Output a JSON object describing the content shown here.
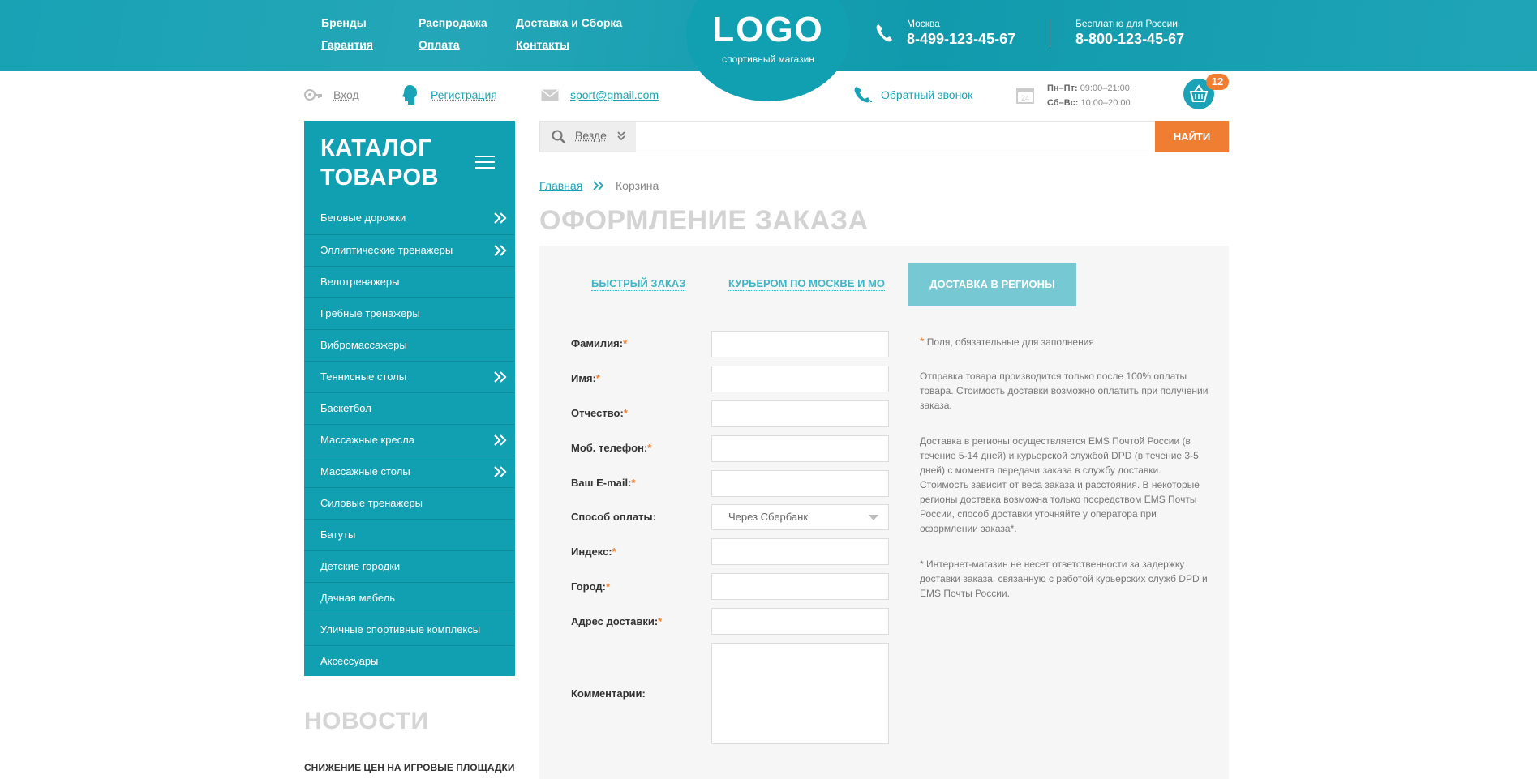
{
  "header": {
    "links": [
      "Бренды",
      "Распродажа",
      "Доставка и Сборка",
      "Гарантия",
      "Оплата",
      "Контакты"
    ],
    "logo": "LOGO",
    "logo_sub": "спортивный магазин",
    "city": "Москва",
    "phone": "8-499-123-45-67",
    "free_label": "Бесплатно для России",
    "free_phone": "8-800-123-45-67"
  },
  "subheader": {
    "login": "Вход",
    "register": "Регистрация",
    "email": "sport@gmail.com",
    "callback": "Обратный звонок",
    "hours_weekday_label": "Пн–Пт:",
    "hours_weekday": "09:00–21:00;",
    "hours_weekend_label": "Сб–Вс:",
    "hours_weekend": "10:00–20:00",
    "cart_count": "12"
  },
  "catalog": {
    "title_line1": "КАТАЛОГ",
    "title_line2": "ТОВАРОВ",
    "items": [
      {
        "label": "Беговые дорожки",
        "has_sub": true
      },
      {
        "label": "Эллиптические тренажеры",
        "has_sub": true
      },
      {
        "label": "Велотренажеры",
        "has_sub": false
      },
      {
        "label": "Гребные тренажеры",
        "has_sub": false
      },
      {
        "label": "Вибромассажеры",
        "has_sub": false
      },
      {
        "label": "Теннисные столы",
        "has_sub": true
      },
      {
        "label": "Баскетбол",
        "has_sub": false
      },
      {
        "label": "Массажные кресла",
        "has_sub": true
      },
      {
        "label": "Массажные столы",
        "has_sub": true
      },
      {
        "label": "Силовые тренажеры",
        "has_sub": false
      },
      {
        "label": "Батуты",
        "has_sub": false
      },
      {
        "label": "Детские городки",
        "has_sub": false
      },
      {
        "label": "Дачная мебель",
        "has_sub": false
      },
      {
        "label": "Уличные спортивные комплексы",
        "has_sub": false
      },
      {
        "label": "Аксессуары",
        "has_sub": false
      }
    ]
  },
  "news": {
    "title": "НОВОСТИ",
    "first_item": "СНИЖЕНИЕ ЦЕН НА ИГРОВЫЕ ПЛОЩАДКИ"
  },
  "search": {
    "scope": "Везде",
    "placeholder": "",
    "button": "НАЙТИ"
  },
  "breadcrumb": {
    "home": "Главная",
    "current": "Корзина"
  },
  "page_title": "ОФОРМЛЕНИЕ ЗАКАЗА",
  "tabs": [
    "БЫСТРЫЙ ЗАКАЗ",
    "КУРЬЕРОМ ПО МОСКВЕ И МО",
    "ДОСТАВКА В РЕГИОНЫ"
  ],
  "form": {
    "last_name": "Фамилия:",
    "first_name": "Имя:",
    "patronymic": "Отчество:",
    "mobile": "Моб. телефон:",
    "email": "Ваш E-mail:",
    "payment": "Способ оплаты:",
    "payment_value": "Через Сбербанк",
    "zip": "Индекс:",
    "city": "Город:",
    "address": "Адрес доставки:",
    "comments": "Комментарии:",
    "required_mark": "*"
  },
  "notes": {
    "required": "Поля, обязательные для заполнения",
    "p1": "Отправка товара производится только после 100% оплаты товара. Стоимость доставки возможно оплатить при получении заказа.",
    "p2": "Доставка в регионы осуществляется EMS Почтой России (в течение 5-14 дней) и курьерской службой DPD (в течение 3-5 дней) с момента передачи заказа в службу доставки. Стоимость зависит от веса заказа и расстояния. В некоторые регионы доставка возможна только посредством EMS Почты России, способ доставки уточняйте у оператора при оформлении заказа*.",
    "p3": "* Интернет-магазин не несет ответственности за задержку доставки заказа, связанную с работой курьерских служб DPD и EMS Почты России."
  },
  "colors": {
    "brand": "#119fb2",
    "accent": "#f07e32",
    "tab_active": "#76c9d3"
  }
}
